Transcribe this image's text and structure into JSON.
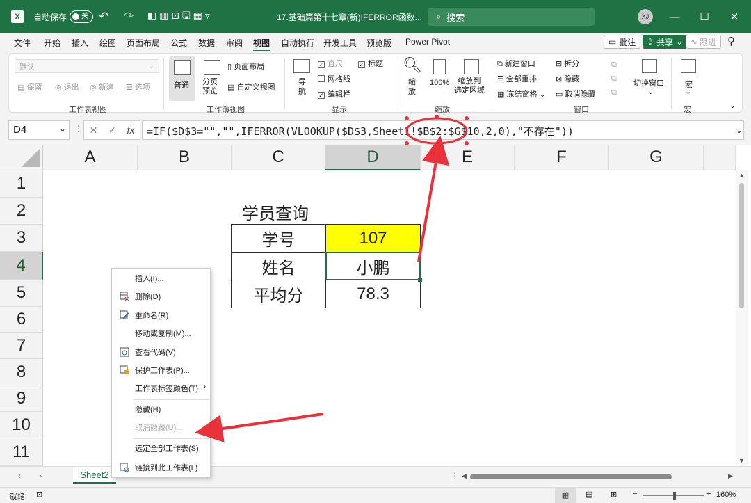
{
  "titlebar": {
    "autosave_label": "自动保存",
    "autosave_state": "关",
    "filename": "17.基础篇第十七章(新)IFERROR函数...",
    "search_placeholder": "搜索",
    "avatar_initials": "XJ",
    "colors": {
      "bar": "#1f7244"
    }
  },
  "menu": {
    "items": [
      "文件",
      "开始",
      "插入",
      "绘图",
      "页面布局",
      "公式",
      "数据",
      "审阅",
      "视图",
      "自动执行",
      "开发工具",
      "预览版",
      "Power Pivot"
    ],
    "active": "视图",
    "comment_btn": "批注",
    "share_btn": "共享",
    "follow_btn": "跟进"
  },
  "ribbon": {
    "sheet_view": {
      "dropdown": "默认",
      "keep": "保留",
      "exit": "退出",
      "new": "新建",
      "options": "选项",
      "group": "工作表视图"
    },
    "workbook_views": {
      "normal": "普通",
      "page_break": "分页\n预览",
      "page_layout": "页面布局",
      "custom": "自定义视图",
      "group": "工作簿视图"
    },
    "show": {
      "ruler": "直尺",
      "gridlines": "网格线",
      "formula_bar": "编辑栏",
      "headings": "标题",
      "navigation": "导\n航",
      "group": "显示"
    },
    "zoom": {
      "zoom": "缩\n放",
      "hundred": "100%",
      "to_selection": "缩放到\n选定区域",
      "group": "缩放"
    },
    "window": {
      "new_window": "新建窗口",
      "arrange_all": "全部重排",
      "freeze": "冻结窗格",
      "split": "拆分",
      "hide": "隐藏",
      "unhide": "取消隐藏",
      "switch": "切换窗口",
      "group": "窗口"
    },
    "macros": {
      "label": "宏",
      "group": "宏"
    }
  },
  "formula_bar": {
    "name_box": "D4",
    "fx": "fx",
    "formula": "=IF($D$3=\"\",\"\",IFERROR(VLOOKUP($D$3,Sheet1!$B$2:$G$10,2,0),\"不存在\"))"
  },
  "grid": {
    "columns": [
      "A",
      "B",
      "C",
      "D",
      "E",
      "F",
      "G"
    ],
    "rows": [
      "1",
      "2",
      "3",
      "4",
      "5",
      "6",
      "7",
      "8",
      "9",
      "10",
      "11"
    ],
    "selected_column": "D",
    "selected_row": "4",
    "title": "学员查询",
    "table": [
      {
        "label": "学号",
        "value": "107"
      },
      {
        "label": "姓名",
        "value": "小鹏"
      },
      {
        "label": "平均分",
        "value": "78.3"
      }
    ],
    "highlight_color": "#ffff00"
  },
  "context_menu": {
    "items": [
      {
        "label": "插入(I)...",
        "icon": "",
        "disabled": false
      },
      {
        "label": "删除(D)",
        "icon": "delete-sheet-icon",
        "disabled": false
      },
      {
        "label": "重命名(R)",
        "icon": "rename-icon",
        "disabled": false
      },
      {
        "label": "移动或复制(M)...",
        "icon": "",
        "disabled": false
      },
      {
        "label": "查看代码(V)",
        "icon": "view-code-icon",
        "disabled": false
      },
      {
        "label": "保护工作表(P)...",
        "icon": "protect-sheet-icon",
        "disabled": false
      },
      {
        "label": "工作表标签颜色(T)",
        "icon": "",
        "disabled": false
      },
      {
        "label": "隐藏(H)",
        "icon": "",
        "disabled": false
      },
      {
        "label": "取消隐藏(U)...",
        "icon": "",
        "disabled": true
      },
      {
        "label": "选定全部工作表(S)",
        "icon": "",
        "disabled": false
      },
      {
        "label": "链接到此工作表(L)",
        "icon": "link-icon",
        "disabled": false
      }
    ]
  },
  "tabs": {
    "active_sheet": "Sheet2"
  },
  "status": {
    "ready": "就绪",
    "zoom": "160%"
  },
  "annotations": {
    "color": "#e8313a"
  }
}
